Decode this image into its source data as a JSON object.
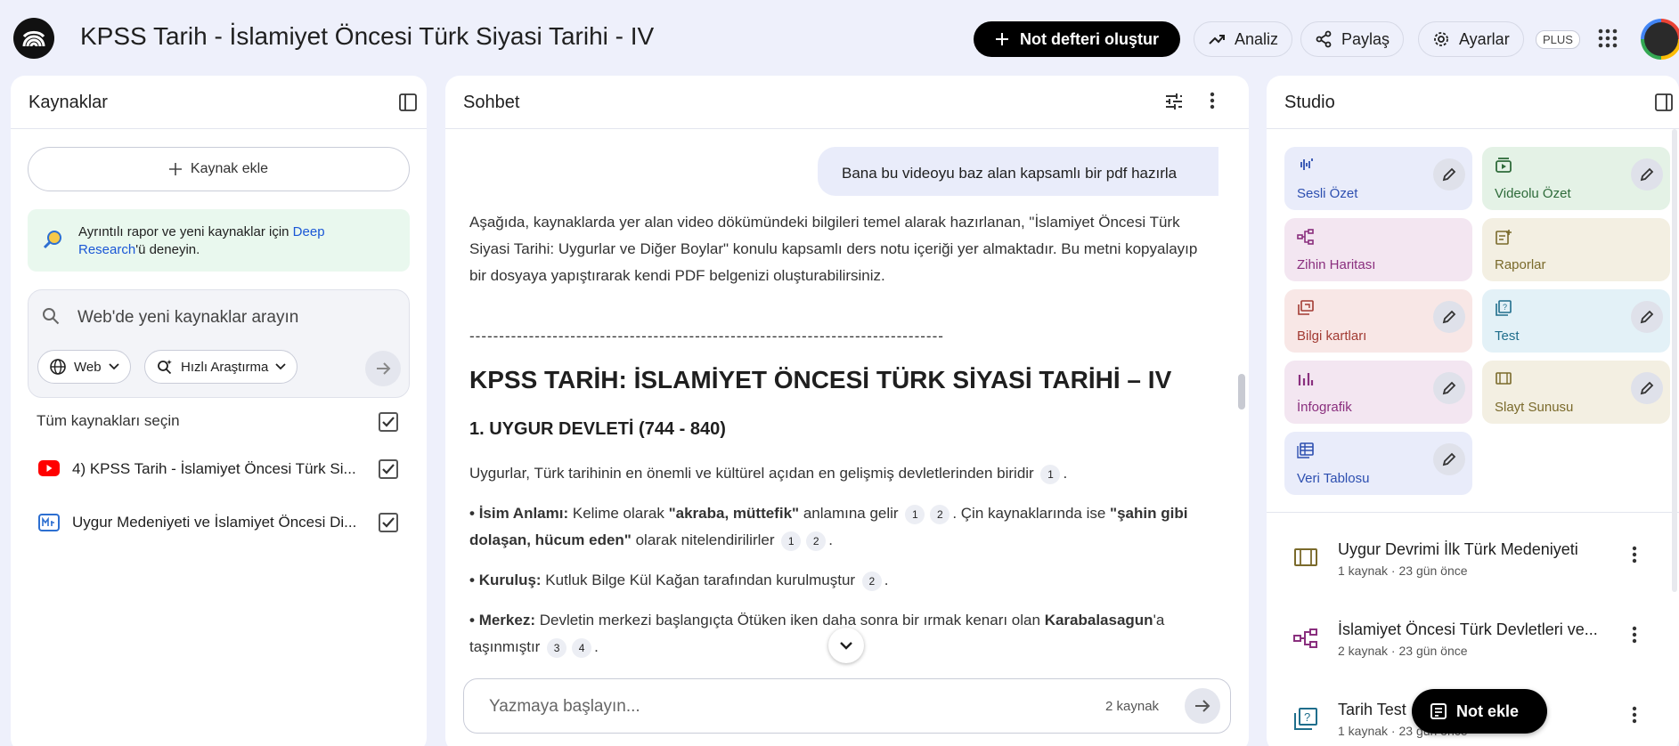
{
  "header": {
    "title": "KPSS Tarih - İslamiyet Öncesi Türk Siyasi Tarihi - IV",
    "new_notebook": "Not defteri oluştur",
    "analytics": "Analiz",
    "share": "Paylaş",
    "settings": "Ayarlar",
    "plan_badge": "PLUS"
  },
  "sources": {
    "title": "Kaynaklar",
    "add_source": "Kaynak ekle",
    "deep_research_prefix": "Ayrıntılı rapor ve yeni kaynaklar için ",
    "deep_research_link": "Deep Research",
    "deep_research_suffix": "'ü deneyin.",
    "search_placeholder": "Web'de yeni kaynaklar arayın",
    "web_filter": "Web",
    "research_mode": "Hızlı Araştırma",
    "select_all": "Tüm kaynakları seçin",
    "items": [
      {
        "label": "4) KPSS Tarih - İslamiyet Öncesi Türk Si...",
        "type": "youtube-icon",
        "checked": true
      },
      {
        "label": "Uygur Medeniyeti ve İslamiyet Öncesi Di...",
        "type": "document-icon",
        "checked": true
      }
    ]
  },
  "chat": {
    "title": "Sohbet",
    "user_message": "Bana bu videoyu baz alan kapsamlı bir pdf hazırla",
    "intro": "Aşağıda, kaynaklarda yer alan video dökümündeki bilgileri temel alarak hazırlanan, \"İslamiyet Öncesi Türk Siyasi Tarihi: Uygurlar ve Diğer Boylar\" konulu kapsamlı ders notu içeriği yer almaktadır. Bu metni kopyalayıp bir dosyaya yapıştırarak kendi PDF belgenizi oluşturabilirsiniz.",
    "divider": "--------------------------------------------------------------------------------",
    "heading": "KPSS TARİH: İSLAMİYET ÖNCESİ TÜRK SİYASİ TARİHİ – IV",
    "section": "1. UYGUR DEVLETİ (744 - 840)",
    "p1": "Uygurlar, Türk tarihinin en önemli ve kültürel açıdan en gelişmiş devletlerinden biridir",
    "b1_label": "İsim Anlamı:",
    "b1_t1": " Kelime olarak ",
    "b1_bold1": "\"akraba, müttefik\"",
    "b1_t2": " anlamına gelir ",
    "b1_t3": ". Çin kaynaklarında ise ",
    "b1_bold2": "\"şahin gibi dolaşan, hücum eden\"",
    "b1_t4": " olarak nitelendirilirler",
    "b2_label": "Kuruluş:",
    "b2_text": " Kutluk Bilge Kül Kağan tarafından kurulmuştur",
    "b3_label": "Merkez:",
    "b3_text": " Devletin merkezi başlangıçta Ötüken iken daha sonra bir ırmak kenarı olan ",
    "b3_bold": "Karabalasagun",
    "b3_text2": "'a taşınmıştır",
    "bullet": "•",
    "c1": "1",
    "c2": "2",
    "c3": "3",
    "c4": "4",
    "composer_placeholder": "Yazmaya başlayın...",
    "source_count": "2 kaynak"
  },
  "studio": {
    "title": "Studio",
    "cards": [
      {
        "label": "Sesli Özet",
        "icon": "audio-wave-icon",
        "color": "#e9ecfa",
        "text_color": "#2d4fb0"
      },
      {
        "label": "Videolu Özet",
        "icon": "video-icon",
        "color": "#e4f2e6",
        "text_color": "#2e6b3a"
      },
      {
        "label": "Zihin Haritası",
        "icon": "mind-map-icon",
        "color": "#f3e6f1",
        "text_color": "#8a2f7e"
      },
      {
        "label": "Raporlar",
        "icon": "report-icon",
        "color": "#f3efe2",
        "text_color": "#7a6a2b"
      },
      {
        "label": "Bilgi kartları",
        "icon": "flashcards-icon",
        "color": "#f8e7e6",
        "text_color": "#a23b33"
      },
      {
        "label": "Test",
        "icon": "quiz-icon",
        "color": "#e3f1f7",
        "text_color": "#1f6e8c"
      },
      {
        "label": "İnfografik",
        "icon": "infographic-icon",
        "color": "#f3e6f1",
        "text_color": "#8a2f7e"
      },
      {
        "label": "Slayt Sunusu",
        "icon": "slides-icon",
        "color": "#f3efe2",
        "text_color": "#7a6a2b"
      },
      {
        "label": "Veri Tablosu",
        "icon": "table-icon",
        "color": "#e9ecfa",
        "text_color": "#2d4fb0"
      }
    ],
    "notes": [
      {
        "title": "Uygur Devrimi İlk Türk Medeniyeti",
        "meta": "1 kaynak · 23 gün önce",
        "icon": "slides-icon"
      },
      {
        "title": "İslamiyet Öncesi Türk Devletleri ve...",
        "meta": "2 kaynak · 23 gün önce",
        "icon": "mind-map-icon"
      },
      {
        "title": "Tarih Test",
        "meta": "1 kaynak · 23 gün önce",
        "icon": "quiz-icon"
      }
    ],
    "add_note": "Not ekle"
  }
}
